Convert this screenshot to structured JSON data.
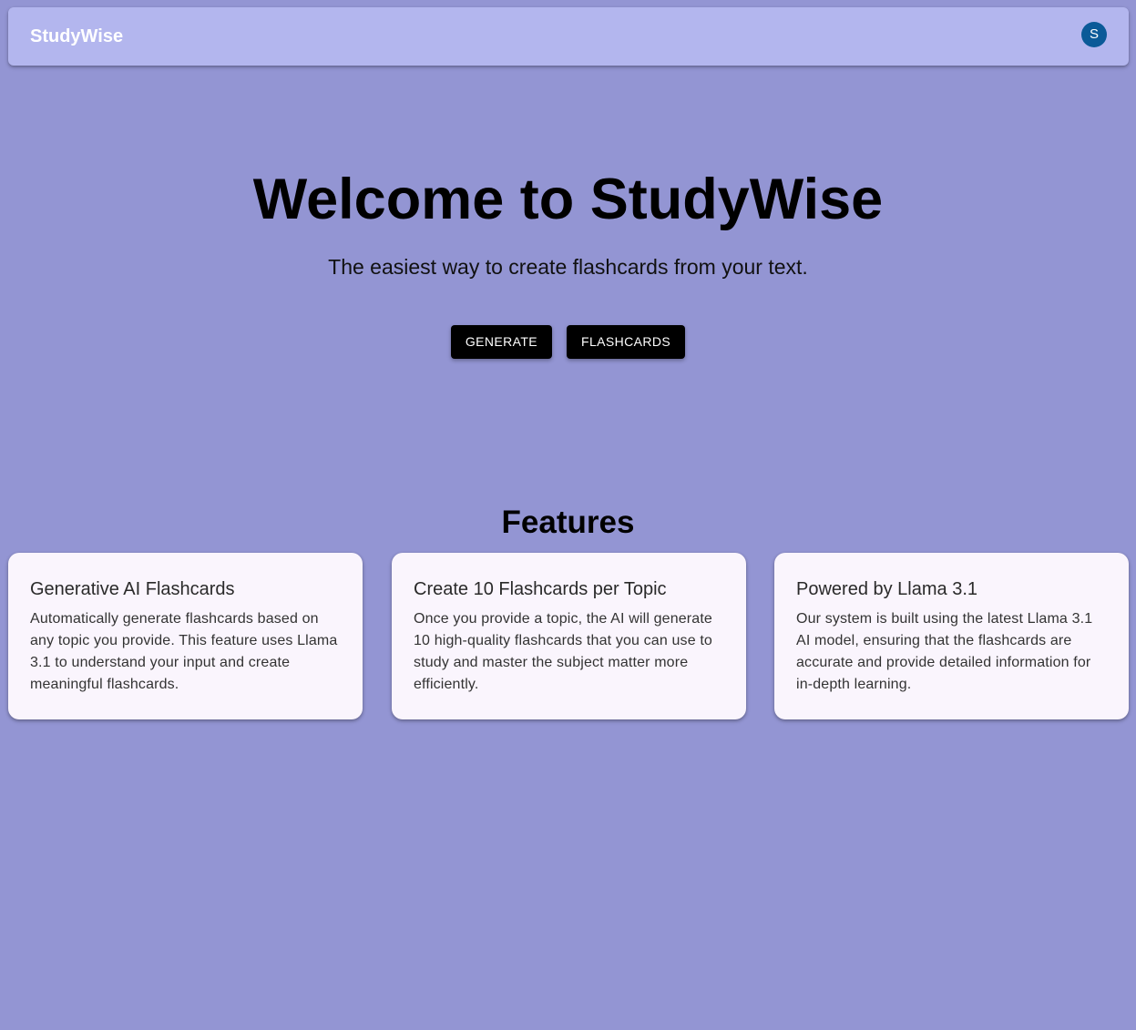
{
  "header": {
    "brand": "StudyWise",
    "avatar_initial": "S"
  },
  "hero": {
    "title": "Welcome to StudyWise",
    "subtitle": "The easiest way to create flashcards from your text.",
    "buttons": [
      {
        "label": "GENERATE"
      },
      {
        "label": "FLASHCARDS"
      }
    ]
  },
  "features": {
    "title": "Features",
    "cards": [
      {
        "title": "Generative AI Flashcards",
        "text": "Automatically generate flashcards based on any topic you provide. This feature uses Llama 3.1 to understand your input and create meaningful flashcards."
      },
      {
        "title": "Create 10 Flashcards per Topic",
        "text": "Once you provide a topic, the AI will generate 10 high-quality flashcards that you can use to study and master the subject matter more efficiently."
      },
      {
        "title": "Powered by Llama 3.1",
        "text": "Our system is built using the latest Llama 3.1 AI model, ensuring that the flashcards are accurate and provide detailed information for in-depth learning."
      }
    ]
  },
  "colors": {
    "background": "#9395d3",
    "appbar": "#b3b6ee",
    "avatar": "#0b5a98",
    "button": "#000000",
    "card": "#faf5fd"
  }
}
